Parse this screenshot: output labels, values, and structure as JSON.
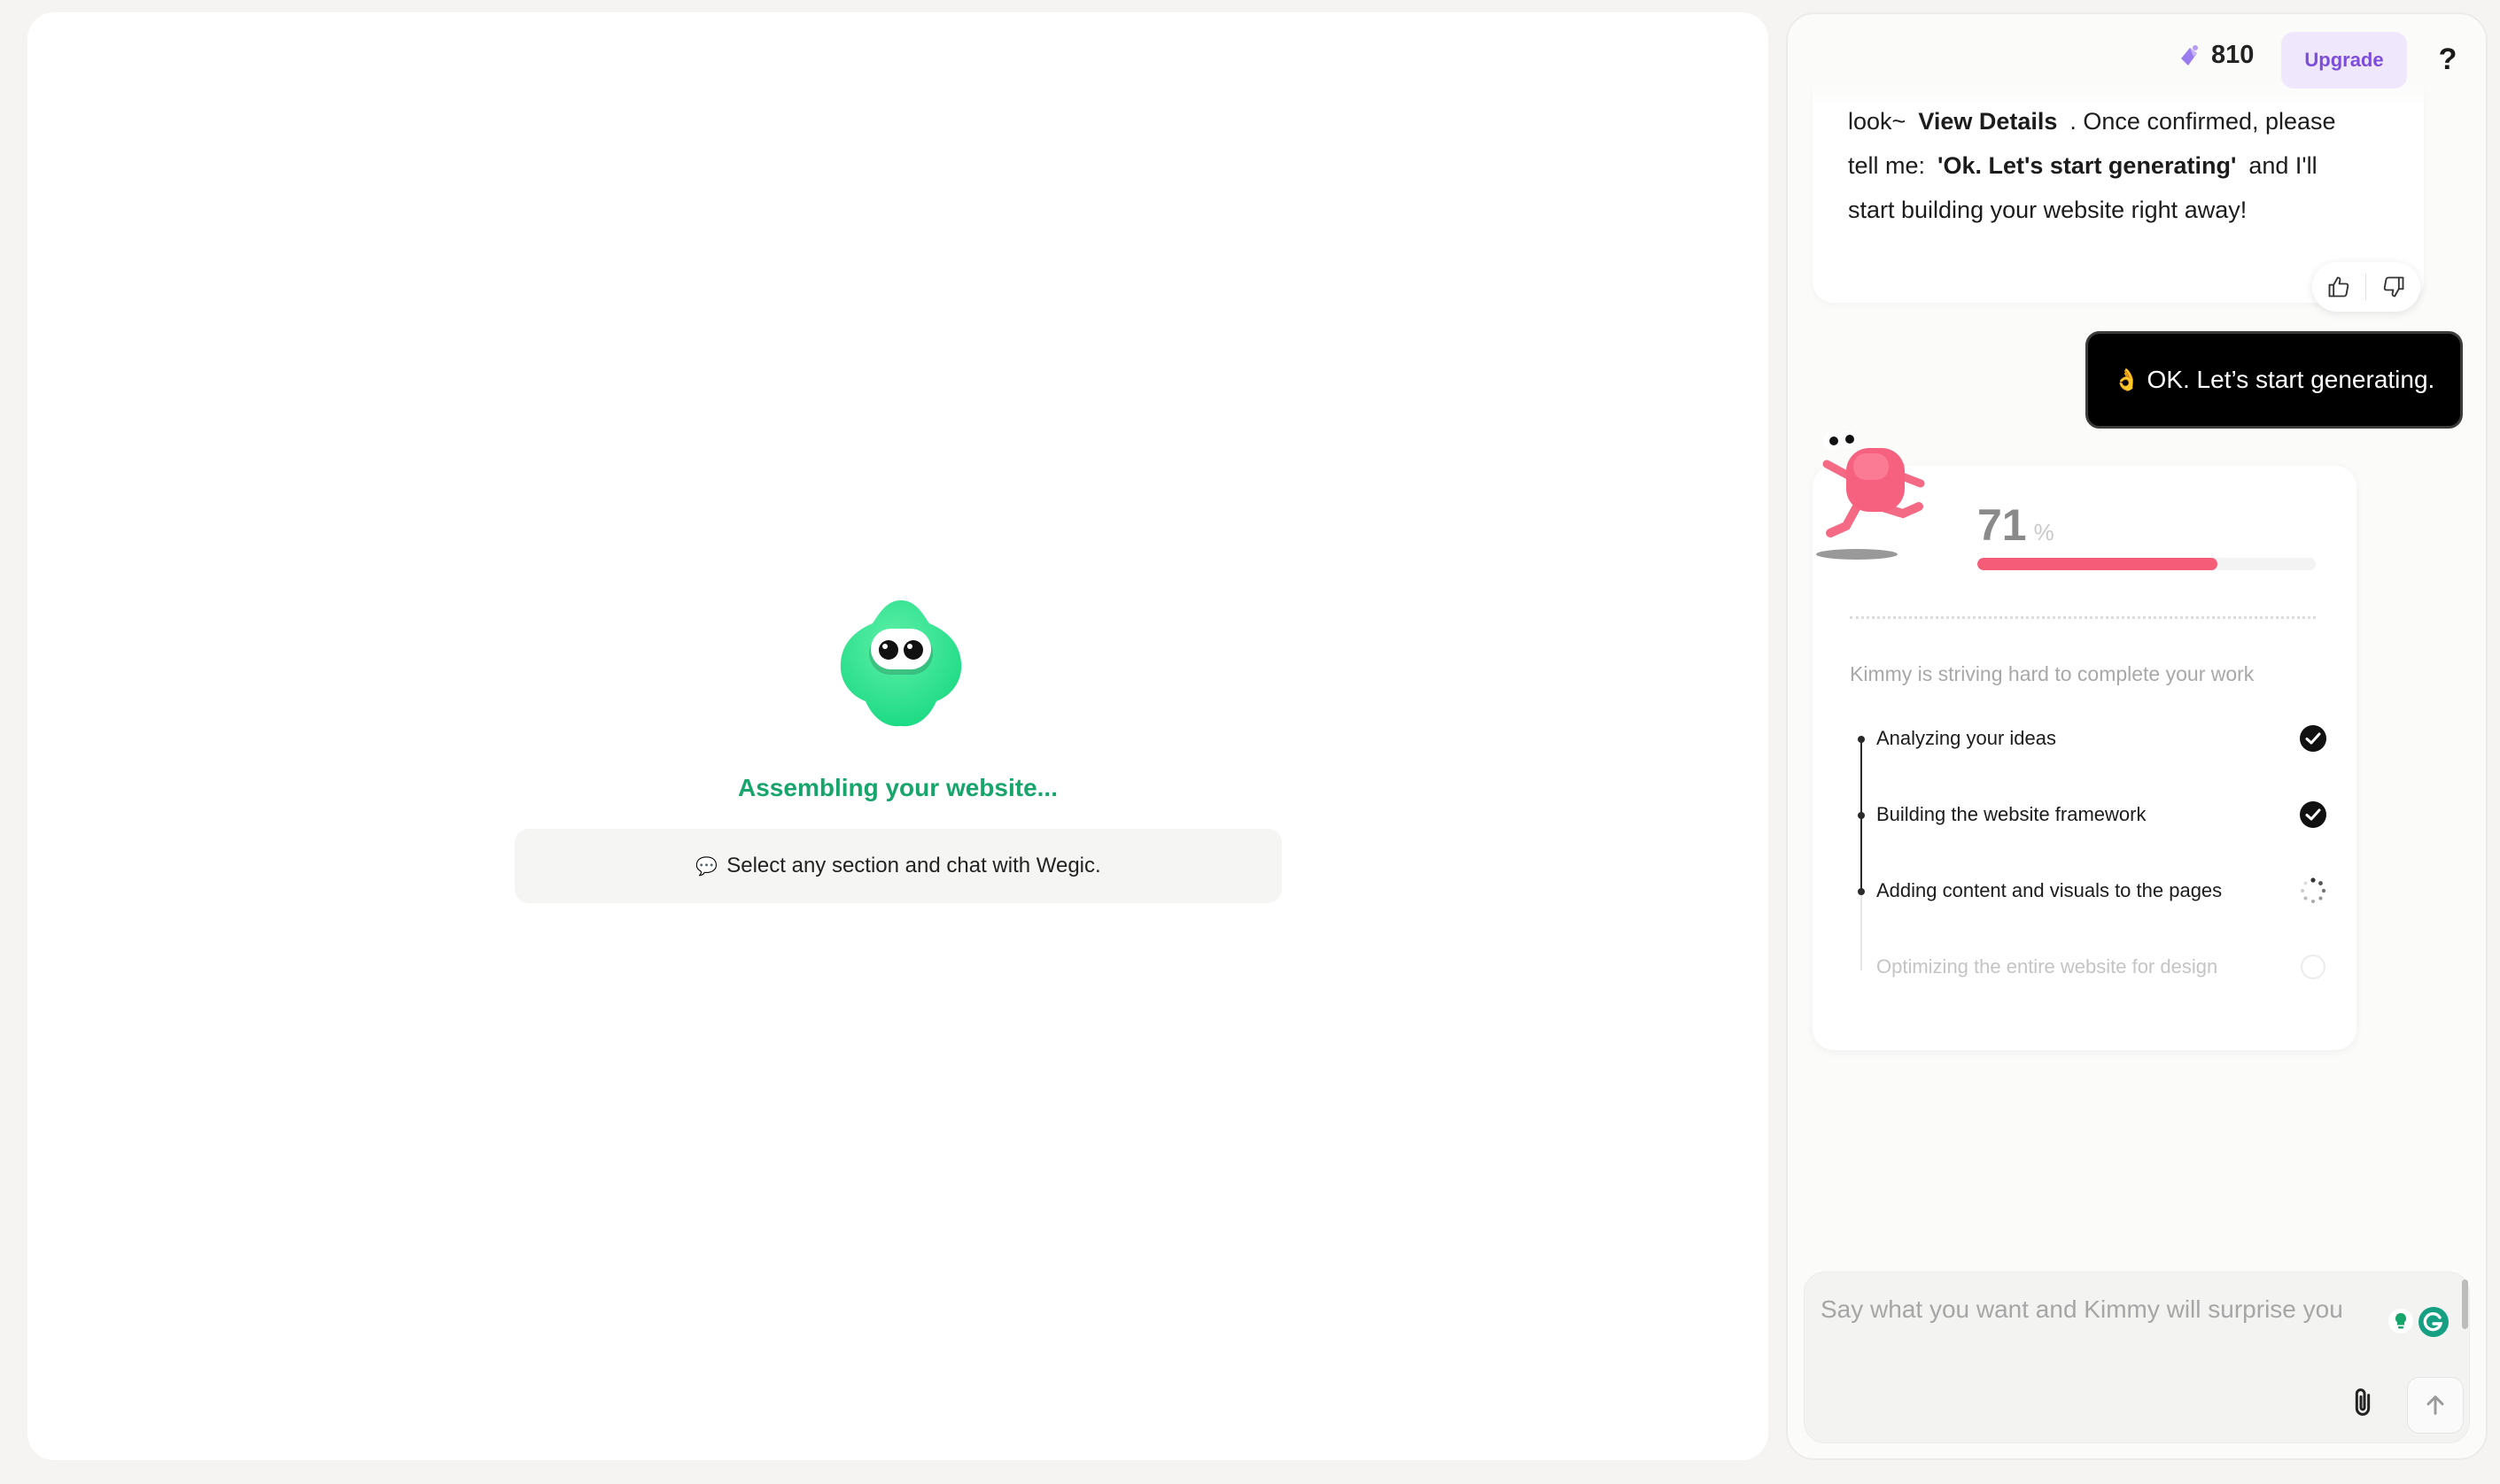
{
  "preview": {
    "status_text": "Assembling your website...",
    "hint_text": "Select any section and chat with Wegic.",
    "hint_icon": "speech-bubble-icon"
  },
  "header": {
    "credits_value": "810",
    "upgrade_label": "Upgrade",
    "help_label": "?",
    "accent_color": "#7c4ddb"
  },
  "assistant_message": {
    "line1_prefix": "look~",
    "link_text": "View Details",
    "line1_suffix": ". Once confirmed, please",
    "line2_prefix": "tell me:",
    "quote": "'Ok. Let's start generating'",
    "line2_suffix": "and I'll",
    "line3": "start building your website right away!"
  },
  "user_message": {
    "emoji": "👌",
    "text": "OK. Let’s start generating."
  },
  "progress": {
    "percent": "71",
    "percent_sign": "%",
    "fraction": 0.71,
    "bar_color": "#f45c77",
    "status_text": "Kimmy is striving hard to complete your work",
    "steps": [
      {
        "label": "Analyzing your ideas",
        "state": "done"
      },
      {
        "label": "Building the website framework",
        "state": "done"
      },
      {
        "label": "Adding content and visuals to the pages",
        "state": "in-progress"
      },
      {
        "label": "Optimizing the entire website for design",
        "state": "pending"
      }
    ]
  },
  "input": {
    "placeholder": "Say what you want and Kimmy will surprise you"
  }
}
